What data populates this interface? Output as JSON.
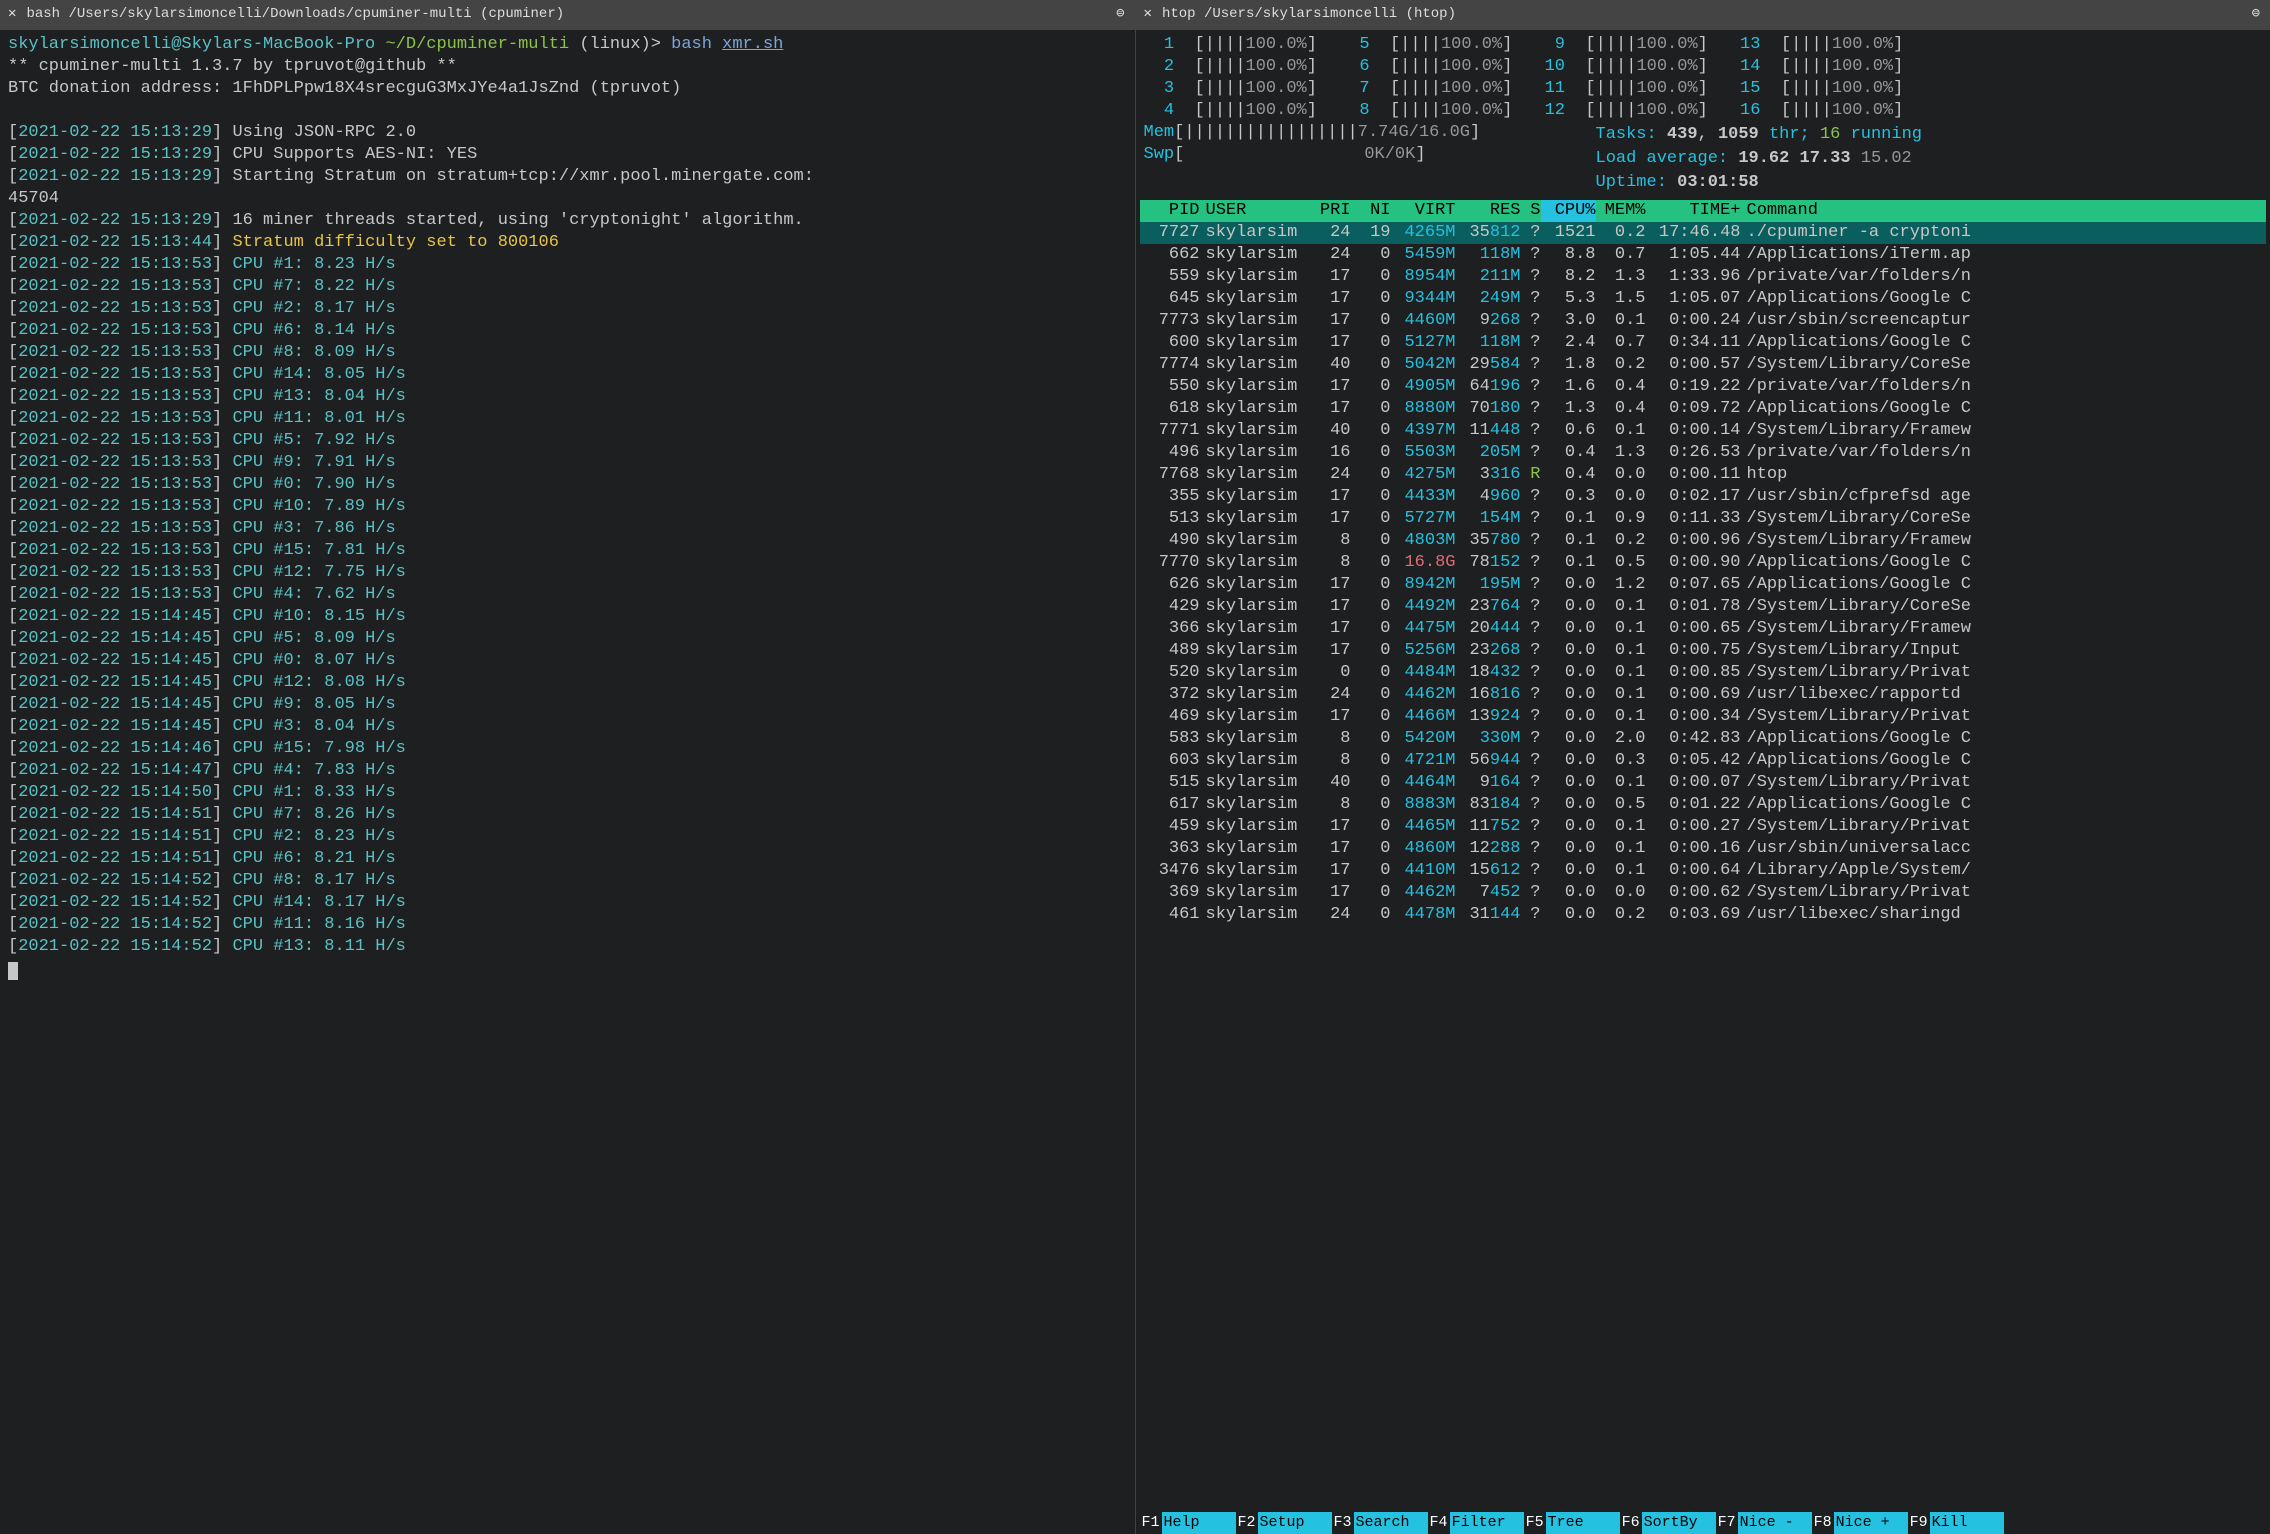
{
  "left": {
    "tab_title": "bash /Users/skylarsimoncelli/Downloads/cpuminer-multi (cpuminer)",
    "prompt": {
      "user_host": "skylarsimoncelli@Skylars-MacBook-Pro",
      "path": "~/D/cpuminer-multi",
      "branch": "(linux)>",
      "cmd": "bash",
      "arg": "xmr.sh"
    },
    "banner1": "** cpuminer-multi 1.3.7 by tpruvot@github **",
    "banner2": "BTC donation address: 1FhDPLPpw18X4srecguG3MxJYe4a1JsZnd (tpruvot)",
    "log_bracket_open": "[",
    "log_bracket_close": "]",
    "startup": [
      {
        "ts": "2021-02-22 15:13:29",
        "msg": "Using JSON-RPC 2.0"
      },
      {
        "ts": "2021-02-22 15:13:29",
        "msg": "CPU Supports AES-NI: YES"
      },
      {
        "ts": "2021-02-22 15:13:29",
        "msg": "Starting Stratum on stratum+tcp://xmr.pool.minergate.com:"
      },
      {
        "ts": "",
        "msg": "45704"
      },
      {
        "ts": "2021-02-22 15:13:29",
        "msg": "16 miner threads started, using 'cryptonight' algorithm."
      }
    ],
    "difficulty": {
      "ts": "2021-02-22 15:13:44",
      "msg": "Stratum difficulty set to 800106"
    },
    "hashrates": [
      {
        "ts": "2021-02-22 15:13:53",
        "cpu": "CPU #1",
        "hs": "8.23 H/s"
      },
      {
        "ts": "2021-02-22 15:13:53",
        "cpu": "CPU #7",
        "hs": "8.22 H/s"
      },
      {
        "ts": "2021-02-22 15:13:53",
        "cpu": "CPU #2",
        "hs": "8.17 H/s"
      },
      {
        "ts": "2021-02-22 15:13:53",
        "cpu": "CPU #6",
        "hs": "8.14 H/s"
      },
      {
        "ts": "2021-02-22 15:13:53",
        "cpu": "CPU #8",
        "hs": "8.09 H/s"
      },
      {
        "ts": "2021-02-22 15:13:53",
        "cpu": "CPU #14",
        "hs": "8.05 H/s"
      },
      {
        "ts": "2021-02-22 15:13:53",
        "cpu": "CPU #13",
        "hs": "8.04 H/s"
      },
      {
        "ts": "2021-02-22 15:13:53",
        "cpu": "CPU #11",
        "hs": "8.01 H/s"
      },
      {
        "ts": "2021-02-22 15:13:53",
        "cpu": "CPU #5",
        "hs": "7.92 H/s"
      },
      {
        "ts": "2021-02-22 15:13:53",
        "cpu": "CPU #9",
        "hs": "7.91 H/s"
      },
      {
        "ts": "2021-02-22 15:13:53",
        "cpu": "CPU #0",
        "hs": "7.90 H/s"
      },
      {
        "ts": "2021-02-22 15:13:53",
        "cpu": "CPU #10",
        "hs": "7.89 H/s"
      },
      {
        "ts": "2021-02-22 15:13:53",
        "cpu": "CPU #3",
        "hs": "7.86 H/s"
      },
      {
        "ts": "2021-02-22 15:13:53",
        "cpu": "CPU #15",
        "hs": "7.81 H/s"
      },
      {
        "ts": "2021-02-22 15:13:53",
        "cpu": "CPU #12",
        "hs": "7.75 H/s"
      },
      {
        "ts": "2021-02-22 15:13:53",
        "cpu": "CPU #4",
        "hs": "7.62 H/s"
      },
      {
        "ts": "2021-02-22 15:14:45",
        "cpu": "CPU #10",
        "hs": "8.15 H/s"
      },
      {
        "ts": "2021-02-22 15:14:45",
        "cpu": "CPU #5",
        "hs": "8.09 H/s"
      },
      {
        "ts": "2021-02-22 15:14:45",
        "cpu": "CPU #0",
        "hs": "8.07 H/s"
      },
      {
        "ts": "2021-02-22 15:14:45",
        "cpu": "CPU #12",
        "hs": "8.08 H/s"
      },
      {
        "ts": "2021-02-22 15:14:45",
        "cpu": "CPU #9",
        "hs": "8.05 H/s"
      },
      {
        "ts": "2021-02-22 15:14:45",
        "cpu": "CPU #3",
        "hs": "8.04 H/s"
      },
      {
        "ts": "2021-02-22 15:14:46",
        "cpu": "CPU #15",
        "hs": "7.98 H/s"
      },
      {
        "ts": "2021-02-22 15:14:47",
        "cpu": "CPU #4",
        "hs": "7.83 H/s"
      },
      {
        "ts": "2021-02-22 15:14:50",
        "cpu": "CPU #1",
        "hs": "8.33 H/s"
      },
      {
        "ts": "2021-02-22 15:14:51",
        "cpu": "CPU #7",
        "hs": "8.26 H/s"
      },
      {
        "ts": "2021-02-22 15:14:51",
        "cpu": "CPU #2",
        "hs": "8.23 H/s"
      },
      {
        "ts": "2021-02-22 15:14:51",
        "cpu": "CPU #6",
        "hs": "8.21 H/s"
      },
      {
        "ts": "2021-02-22 15:14:52",
        "cpu": "CPU #8",
        "hs": "8.17 H/s"
      },
      {
        "ts": "2021-02-22 15:14:52",
        "cpu": "CPU #14",
        "hs": "8.17 H/s"
      },
      {
        "ts": "2021-02-22 15:14:52",
        "cpu": "CPU #11",
        "hs": "8.16 H/s"
      },
      {
        "ts": "2021-02-22 15:14:52",
        "cpu": "CPU #13",
        "hs": "8.11 H/s"
      }
    ]
  },
  "right": {
    "tab_title": "htop /Users/skylarsimoncelli (htop)",
    "cpu_meters": [
      {
        "n": "1",
        "pct": "100.0%"
      },
      {
        "n": "2",
        "pct": "100.0%"
      },
      {
        "n": "3",
        "pct": "100.0%"
      },
      {
        "n": "4",
        "pct": "100.0%"
      },
      {
        "n": "5",
        "pct": "100.0%"
      },
      {
        "n": "6",
        "pct": "100.0%"
      },
      {
        "n": "7",
        "pct": "100.0%"
      },
      {
        "n": "8",
        "pct": "100.0%"
      },
      {
        "n": "9",
        "pct": "100.0%"
      },
      {
        "n": "10",
        "pct": "100.0%"
      },
      {
        "n": "11",
        "pct": "100.0%"
      },
      {
        "n": "12",
        "pct": "100.0%"
      },
      {
        "n": "13",
        "pct": "100.0%"
      },
      {
        "n": "14",
        "pct": "100.0%"
      },
      {
        "n": "15",
        "pct": "100.0%"
      },
      {
        "n": "16",
        "pct": "100.0%"
      }
    ],
    "mem": {
      "used": "7.74G",
      "total": "16.0G"
    },
    "swp": {
      "used": "0K",
      "total": "0K"
    },
    "tasks": {
      "tasks": "439",
      "thr": "1059",
      "running": "16"
    },
    "load": {
      "l1": "19.62",
      "l5": "17.33",
      "l15": "15.02"
    },
    "uptime": "03:01:58",
    "columns": {
      "pid": "PID",
      "user": "USER",
      "pri": "PRI",
      "ni": "NI",
      "virt": "VIRT",
      "res": "RES",
      "s": "S",
      "cpu": "CPU%",
      "mem": "MEM%",
      "time": "TIME+",
      "cmd": "Command"
    },
    "procs": [
      {
        "pid": "7727",
        "user": "skylarsim",
        "pri": "24",
        "ni": "19",
        "virt": "4265M",
        "res": "35812",
        "s": "?",
        "cpu": "1521",
        "mem": "0.2",
        "time": "17:46.48",
        "cmd": "./cpuminer -a cryptoni",
        "sel": true
      },
      {
        "pid": "662",
        "user": "skylarsim",
        "pri": "24",
        "ni": "0",
        "virt": "5459M",
        "res": "118M",
        "s": "?",
        "cpu": "8.8",
        "mem": "0.7",
        "time": "1:05.44",
        "cmd": "/Applications/iTerm.ap"
      },
      {
        "pid": "559",
        "user": "skylarsim",
        "pri": "17",
        "ni": "0",
        "virt": "8954M",
        "res": "211M",
        "s": "?",
        "cpu": "8.2",
        "mem": "1.3",
        "time": "1:33.96",
        "cmd": "/private/var/folders/n"
      },
      {
        "pid": "645",
        "user": "skylarsim",
        "pri": "17",
        "ni": "0",
        "virt": "9344M",
        "res": "249M",
        "s": "?",
        "cpu": "5.3",
        "mem": "1.5",
        "time": "1:05.07",
        "cmd": "/Applications/Google C"
      },
      {
        "pid": "7773",
        "user": "skylarsim",
        "pri": "17",
        "ni": "0",
        "virt": "4460M",
        "res": "9268",
        "s": "?",
        "cpu": "3.0",
        "mem": "0.1",
        "time": "0:00.24",
        "cmd": "/usr/sbin/screencaptur"
      },
      {
        "pid": "600",
        "user": "skylarsim",
        "pri": "17",
        "ni": "0",
        "virt": "5127M",
        "res": "118M",
        "s": "?",
        "cpu": "2.4",
        "mem": "0.7",
        "time": "0:34.11",
        "cmd": "/Applications/Google C"
      },
      {
        "pid": "7774",
        "user": "skylarsim",
        "pri": "40",
        "ni": "0",
        "virt": "5042M",
        "res": "29584",
        "s": "?",
        "cpu": "1.8",
        "mem": "0.2",
        "time": "0:00.57",
        "cmd": "/System/Library/CoreSe"
      },
      {
        "pid": "550",
        "user": "skylarsim",
        "pri": "17",
        "ni": "0",
        "virt": "4905M",
        "res": "64196",
        "s": "?",
        "cpu": "1.6",
        "mem": "0.4",
        "time": "0:19.22",
        "cmd": "/private/var/folders/n"
      },
      {
        "pid": "618",
        "user": "skylarsim",
        "pri": "17",
        "ni": "0",
        "virt": "8880M",
        "res": "70180",
        "s": "?",
        "cpu": "1.3",
        "mem": "0.4",
        "time": "0:09.72",
        "cmd": "/Applications/Google C"
      },
      {
        "pid": "7771",
        "user": "skylarsim",
        "pri": "40",
        "ni": "0",
        "virt": "4397M",
        "res": "11448",
        "s": "?",
        "cpu": "0.6",
        "mem": "0.1",
        "time": "0:00.14",
        "cmd": "/System/Library/Framew"
      },
      {
        "pid": "496",
        "user": "skylarsim",
        "pri": "16",
        "ni": "0",
        "virt": "5503M",
        "res": "205M",
        "s": "?",
        "cpu": "0.4",
        "mem": "1.3",
        "time": "0:26.53",
        "cmd": "/private/var/folders/n"
      },
      {
        "pid": "7768",
        "user": "skylarsim",
        "pri": "24",
        "ni": "0",
        "virt": "4275M",
        "res": "3316",
        "s": "R",
        "cpu": "0.4",
        "mem": "0.0",
        "time": "0:00.11",
        "cmd": "htop"
      },
      {
        "pid": "355",
        "user": "skylarsim",
        "pri": "17",
        "ni": "0",
        "virt": "4433M",
        "res": "4960",
        "s": "?",
        "cpu": "0.3",
        "mem": "0.0",
        "time": "0:02.17",
        "cmd": "/usr/sbin/cfprefsd age"
      },
      {
        "pid": "513",
        "user": "skylarsim",
        "pri": "17",
        "ni": "0",
        "virt": "5727M",
        "res": "154M",
        "s": "?",
        "cpu": "0.1",
        "mem": "0.9",
        "time": "0:11.33",
        "cmd": "/System/Library/CoreSe"
      },
      {
        "pid": "490",
        "user": "skylarsim",
        "pri": "8",
        "ni": "0",
        "virt": "4803M",
        "res": "35780",
        "s": "?",
        "cpu": "0.1",
        "mem": "0.2",
        "time": "0:00.96",
        "cmd": "/System/Library/Framew"
      },
      {
        "pid": "7770",
        "user": "skylarsim",
        "pri": "8",
        "ni": "0",
        "virt": "16.8G",
        "res": "78152",
        "s": "?",
        "cpu": "0.1",
        "mem": "0.5",
        "time": "0:00.90",
        "cmd": "/Applications/Google C",
        "virt_red": true
      },
      {
        "pid": "626",
        "user": "skylarsim",
        "pri": "17",
        "ni": "0",
        "virt": "8942M",
        "res": "195M",
        "s": "?",
        "cpu": "0.0",
        "mem": "1.2",
        "time": "0:07.65",
        "cmd": "/Applications/Google C"
      },
      {
        "pid": "429",
        "user": "skylarsim",
        "pri": "17",
        "ni": "0",
        "virt": "4492M",
        "res": "23764",
        "s": "?",
        "cpu": "0.0",
        "mem": "0.1",
        "time": "0:01.78",
        "cmd": "/System/Library/CoreSe"
      },
      {
        "pid": "366",
        "user": "skylarsim",
        "pri": "17",
        "ni": "0",
        "virt": "4475M",
        "res": "20444",
        "s": "?",
        "cpu": "0.0",
        "mem": "0.1",
        "time": "0:00.65",
        "cmd": "/System/Library/Framew"
      },
      {
        "pid": "489",
        "user": "skylarsim",
        "pri": "17",
        "ni": "0",
        "virt": "5256M",
        "res": "23268",
        "s": "?",
        "cpu": "0.0",
        "mem": "0.1",
        "time": "0:00.75",
        "cmd": "/System/Library/Input"
      },
      {
        "pid": "520",
        "user": "skylarsim",
        "pri": "0",
        "ni": "0",
        "virt": "4484M",
        "res": "18432",
        "s": "?",
        "cpu": "0.0",
        "mem": "0.1",
        "time": "0:00.85",
        "cmd": "/System/Library/Privat"
      },
      {
        "pid": "372",
        "user": "skylarsim",
        "pri": "24",
        "ni": "0",
        "virt": "4462M",
        "res": "16816",
        "s": "?",
        "cpu": "0.0",
        "mem": "0.1",
        "time": "0:00.69",
        "cmd": "/usr/libexec/rapportd"
      },
      {
        "pid": "469",
        "user": "skylarsim",
        "pri": "17",
        "ni": "0",
        "virt": "4466M",
        "res": "13924",
        "s": "?",
        "cpu": "0.0",
        "mem": "0.1",
        "time": "0:00.34",
        "cmd": "/System/Library/Privat"
      },
      {
        "pid": "583",
        "user": "skylarsim",
        "pri": "8",
        "ni": "0",
        "virt": "5420M",
        "res": "330M",
        "s": "?",
        "cpu": "0.0",
        "mem": "2.0",
        "time": "0:42.83",
        "cmd": "/Applications/Google C"
      },
      {
        "pid": "603",
        "user": "skylarsim",
        "pri": "8",
        "ni": "0",
        "virt": "4721M",
        "res": "56944",
        "s": "?",
        "cpu": "0.0",
        "mem": "0.3",
        "time": "0:05.42",
        "cmd": "/Applications/Google C"
      },
      {
        "pid": "515",
        "user": "skylarsim",
        "pri": "40",
        "ni": "0",
        "virt": "4464M",
        "res": "9164",
        "s": "?",
        "cpu": "0.0",
        "mem": "0.1",
        "time": "0:00.07",
        "cmd": "/System/Library/Privat"
      },
      {
        "pid": "617",
        "user": "skylarsim",
        "pri": "8",
        "ni": "0",
        "virt": "8883M",
        "res": "83184",
        "s": "?",
        "cpu": "0.0",
        "mem": "0.5",
        "time": "0:01.22",
        "cmd": "/Applications/Google C"
      },
      {
        "pid": "459",
        "user": "skylarsim",
        "pri": "17",
        "ni": "0",
        "virt": "4465M",
        "res": "11752",
        "s": "?",
        "cpu": "0.0",
        "mem": "0.1",
        "time": "0:00.27",
        "cmd": "/System/Library/Privat"
      },
      {
        "pid": "363",
        "user": "skylarsim",
        "pri": "17",
        "ni": "0",
        "virt": "4860M",
        "res": "12288",
        "s": "?",
        "cpu": "0.0",
        "mem": "0.1",
        "time": "0:00.16",
        "cmd": "/usr/sbin/universalacc"
      },
      {
        "pid": "3476",
        "user": "skylarsim",
        "pri": "17",
        "ni": "0",
        "virt": "4410M",
        "res": "15612",
        "s": "?",
        "cpu": "0.0",
        "mem": "0.1",
        "time": "0:00.64",
        "cmd": "/Library/Apple/System/"
      },
      {
        "pid": "369",
        "user": "skylarsim",
        "pri": "17",
        "ni": "0",
        "virt": "4462M",
        "res": "7452",
        "s": "?",
        "cpu": "0.0",
        "mem": "0.0",
        "time": "0:00.62",
        "cmd": "/System/Library/Privat"
      },
      {
        "pid": "461",
        "user": "skylarsim",
        "pri": "24",
        "ni": "0",
        "virt": "4478M",
        "res": "31144",
        "s": "?",
        "cpu": "0.0",
        "mem": "0.2",
        "time": "0:03.69",
        "cmd": "/usr/libexec/sharingd"
      }
    ],
    "footer": [
      {
        "k": "F1",
        "l": "Help"
      },
      {
        "k": "F2",
        "l": "Setup"
      },
      {
        "k": "F3",
        "l": "Search"
      },
      {
        "k": "F4",
        "l": "Filter"
      },
      {
        "k": "F5",
        "l": "Tree"
      },
      {
        "k": "F6",
        "l": "SortBy"
      },
      {
        "k": "F7",
        "l": "Nice -"
      },
      {
        "k": "F8",
        "l": "Nice +"
      },
      {
        "k": "F9",
        "l": "Kill"
      }
    ]
  }
}
